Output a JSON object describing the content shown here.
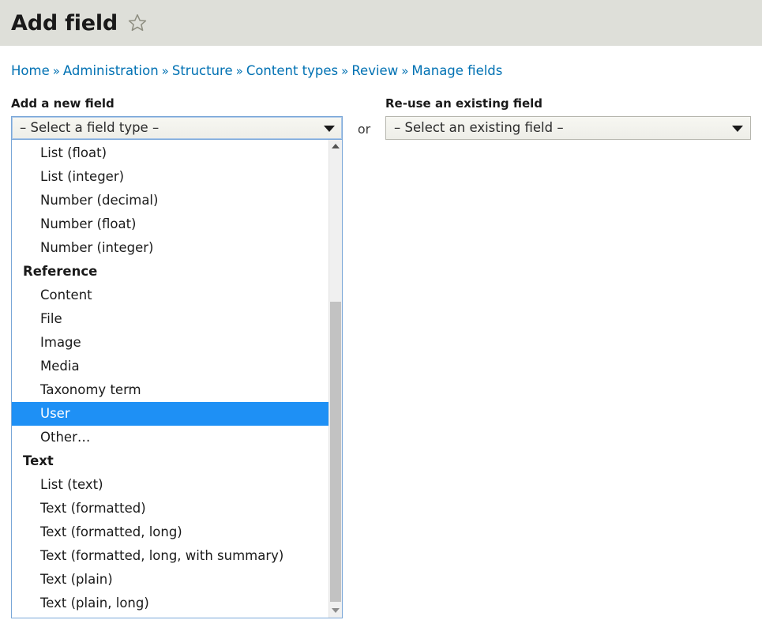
{
  "header": {
    "title": "Add field",
    "star_icon": "star-outline-icon"
  },
  "breadcrumb": {
    "separator": "»",
    "items": [
      {
        "label": "Home"
      },
      {
        "label": "Administration"
      },
      {
        "label": "Structure"
      },
      {
        "label": "Content types"
      },
      {
        "label": "Review"
      },
      {
        "label": "Manage fields"
      }
    ]
  },
  "form": {
    "new_field": {
      "label": "Add a new field",
      "selected_value": "– Select a field type –",
      "caret_icon": "chevron-down-icon",
      "expanded": true,
      "options": [
        {
          "label": "List (float)",
          "type": "option",
          "selected": false
        },
        {
          "label": "List (integer)",
          "type": "option",
          "selected": false
        },
        {
          "label": "Number (decimal)",
          "type": "option",
          "selected": false
        },
        {
          "label": "Number (float)",
          "type": "option",
          "selected": false
        },
        {
          "label": "Number (integer)",
          "type": "option",
          "selected": false
        },
        {
          "label": "Reference",
          "type": "group",
          "selected": false
        },
        {
          "label": "Content",
          "type": "option",
          "selected": false
        },
        {
          "label": "File",
          "type": "option",
          "selected": false
        },
        {
          "label": "Image",
          "type": "option",
          "selected": false
        },
        {
          "label": "Media",
          "type": "option",
          "selected": false
        },
        {
          "label": "Taxonomy term",
          "type": "option",
          "selected": false
        },
        {
          "label": "User",
          "type": "option",
          "selected": true
        },
        {
          "label": "Other…",
          "type": "option",
          "selected": false
        },
        {
          "label": "Text",
          "type": "group",
          "selected": false
        },
        {
          "label": "List (text)",
          "type": "option",
          "selected": false
        },
        {
          "label": "Text (formatted)",
          "type": "option",
          "selected": false
        },
        {
          "label": "Text (formatted, long)",
          "type": "option",
          "selected": false
        },
        {
          "label": "Text (formatted, long, with summary)",
          "type": "option",
          "selected": false
        },
        {
          "label": "Text (plain)",
          "type": "option",
          "selected": false
        },
        {
          "label": "Text (plain, long)",
          "type": "option",
          "selected": false
        }
      ],
      "scrollbar": {
        "up_arrow_icon": "scroll-up-arrow-icon",
        "down_arrow_icon": "scroll-down-arrow-icon"
      }
    },
    "or_label": "or",
    "existing_field": {
      "label": "Re-use an existing field",
      "selected_value": "– Select an existing field –",
      "caret_icon": "chevron-down-icon"
    }
  },
  "colors": {
    "header_band": "#dedfd9",
    "link": "#0071b3",
    "highlight": "#1e90f5",
    "focus_border": "#7aa7d8"
  }
}
